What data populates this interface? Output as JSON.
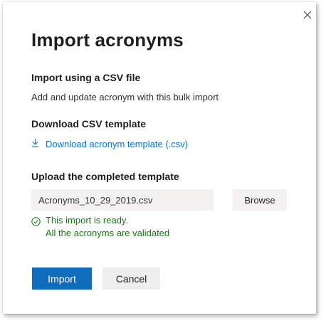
{
  "dialog": {
    "title": "Import acronyms",
    "close_icon": "close-icon"
  },
  "csv_section": {
    "heading": "Import using a CSV file",
    "description": "Add and update acronym with this bulk import"
  },
  "template_section": {
    "heading": "Download CSV template",
    "link_label": "Download acronym template (.csv)",
    "link_icon": "download-icon"
  },
  "upload_section": {
    "heading": "Upload the completed template",
    "file_name": "Acronyms_10_29_2019.csv",
    "browse_label": "Browse"
  },
  "status": {
    "icon": "check-circle-icon",
    "line1": "This import is ready.",
    "line2": "All the acronyms are validated"
  },
  "actions": {
    "import_label": "Import",
    "cancel_label": "Cancel"
  },
  "colors": {
    "accent": "#0f6cbd",
    "link": "#0078d4",
    "success": "#107c10",
    "input_background": "#f3f2f1"
  }
}
